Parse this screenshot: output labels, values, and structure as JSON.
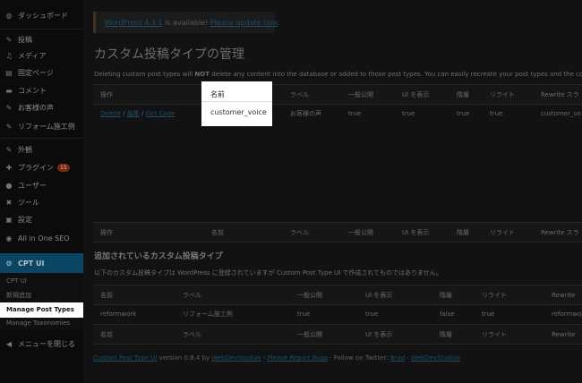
{
  "sidebar": {
    "items": [
      {
        "icon": "dashboard-icon",
        "glyph": "◍",
        "label": "ダッシュボード",
        "badge": ""
      },
      {
        "icon": "pin-icon",
        "glyph": "✎",
        "label": "投稿",
        "badge": ""
      },
      {
        "icon": "media-icon",
        "glyph": "♫",
        "label": "メディア",
        "badge": ""
      },
      {
        "icon": "page-icon",
        "glyph": "▤",
        "label": "固定ページ",
        "badge": ""
      },
      {
        "icon": "comment-icon",
        "glyph": "▬",
        "label": "コメント",
        "badge": ""
      },
      {
        "icon": "pin-icon",
        "glyph": "✎",
        "label": "お客様の声",
        "badge": ""
      },
      {
        "icon": "pin-icon",
        "glyph": "✎",
        "label": "リフォーム施工例",
        "badge": ""
      },
      {
        "icon": "appearance-icon",
        "glyph": "✎",
        "label": "外観",
        "badge": ""
      },
      {
        "icon": "plugin-icon",
        "glyph": "✚",
        "label": "プラグイン",
        "badge": "15"
      },
      {
        "icon": "user-icon",
        "glyph": "●",
        "label": "ユーザー",
        "badge": ""
      },
      {
        "icon": "tools-icon",
        "glyph": "✖",
        "label": "ツール",
        "badge": ""
      },
      {
        "icon": "settings-icon",
        "glyph": "▣",
        "label": "設定",
        "badge": ""
      },
      {
        "icon": "seo-icon",
        "glyph": "◉",
        "label": "All in One SEO",
        "badge": ""
      }
    ],
    "active": {
      "icon": "gear-icon",
      "glyph": "⚙",
      "label": "CPT UI"
    },
    "submenu": [
      "CPT UI",
      "新規追加",
      "Manage Post Types",
      "Manage Taxonomies"
    ],
    "collapse": {
      "icon": "collapse-icon",
      "glyph": "◀",
      "label": "メニューを閉じる"
    }
  },
  "notice": {
    "link1": "WordPress 4.3.1",
    "middle": " is available! ",
    "link2": "Please update now",
    "end": "."
  },
  "page": {
    "title": "カスタム投稿タイプの管理",
    "warning_pre": "Deleting custom post types will ",
    "warning_bold": "NOT",
    "warning_post": " delete any content into the database or added to those post types. You can easily recreate your post types and the content"
  },
  "table1": {
    "headers": [
      "操作",
      "名前",
      "ラベル",
      "一般公開",
      "UI を表示",
      "階層",
      "リライト",
      "Rewrite スラ"
    ],
    "row": {
      "actions": [
        "Delete",
        "編集",
        "Get Code"
      ],
      "cells": [
        "customer_voice",
        "お客様の声",
        "true",
        "true",
        "true",
        "true",
        "customer_vo"
      ]
    }
  },
  "section2": {
    "title": "追加されているカスタム投稿タイプ",
    "desc": "以下のカスタム投稿タイプは WordPress に登録されていますが Custom Post Type UI で作成されてものではありません。"
  },
  "table2": {
    "headers": [
      "名前",
      "ラベル",
      "一般公開",
      "UI を表示",
      "階層",
      "リライト",
      "Rewrite"
    ],
    "row": [
      "reformwork",
      "リフォーム施工例",
      "true",
      "true",
      "false",
      "true",
      "reformwork"
    ]
  },
  "footer": {
    "link1": "Custom Post Type UI",
    "t1": " version 0.8.4 by ",
    "link2": "WebDevStudios",
    "t2": " - ",
    "link3": "Please Report Bugs",
    "t3": " · Follow on Twitter: ",
    "link4": "Brad",
    "t4": " · ",
    "link5": "WebDevStudios"
  }
}
